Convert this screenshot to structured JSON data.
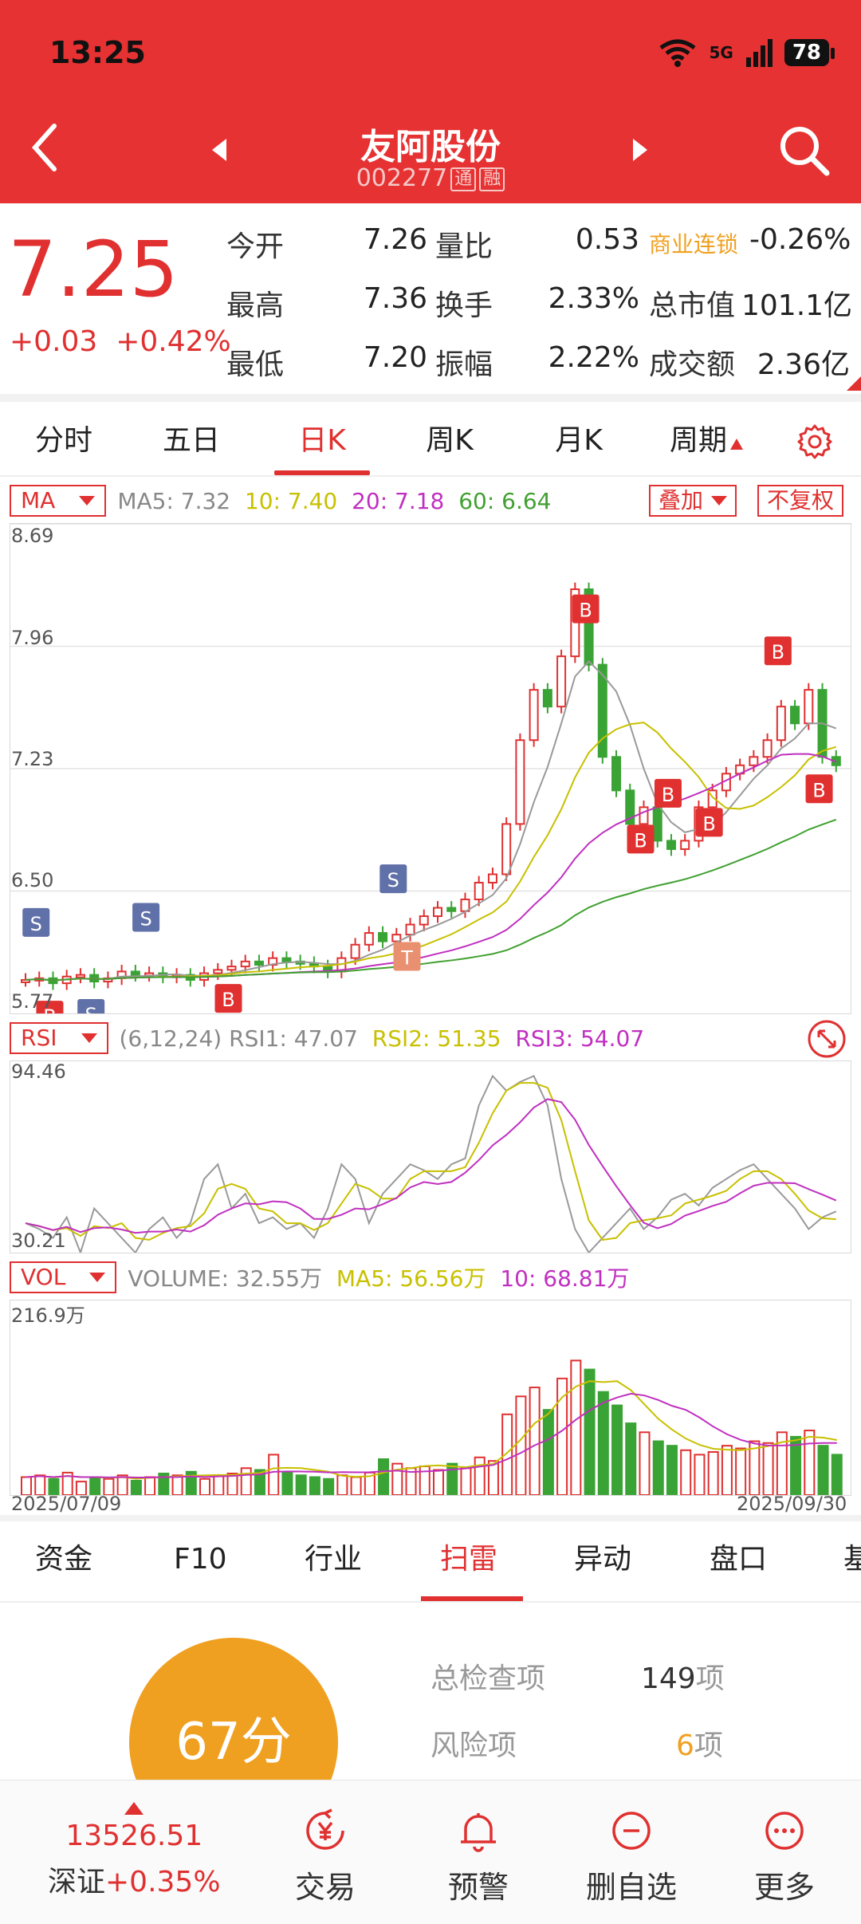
{
  "status": {
    "time": "13:25",
    "net": "5G",
    "battery": "78"
  },
  "header": {
    "name": "友阿股份",
    "code": "002277",
    "badge1": "通",
    "badge2": "融"
  },
  "quote": {
    "price": "7.25",
    "change": "+0.03",
    "change_pct": "+0.42%",
    "open_label": "今开",
    "open": "7.26",
    "high_label": "最高",
    "high": "7.36",
    "low_label": "最低",
    "low": "7.20",
    "vol_ratio_label": "量比",
    "vol_ratio": "0.53",
    "turnover_label": "换手",
    "turnover": "2.33%",
    "amplitude_label": "振幅",
    "amplitude": "2.22%",
    "sector_label": "商业连锁",
    "sector_change": "-0.26%",
    "mcap_label": "总市值",
    "mcap": "101.1亿",
    "amount_label": "成交额",
    "amount": "2.36亿"
  },
  "tabs": [
    "分时",
    "五日",
    "日K",
    "周K",
    "月K",
    "周期"
  ],
  "ma_bar": {
    "select": "MA",
    "ma5": "MA5: 7.32",
    "ma10": "10: 7.40",
    "ma20": "20: 7.18",
    "ma60": "60: 6.64",
    "overlay": "叠加",
    "adjust": "不复权"
  },
  "kline": {
    "y_ticks": [
      "8.69",
      "7.96",
      "7.23",
      "6.50",
      "5.77"
    ]
  },
  "rsi_bar": {
    "select": "RSI",
    "params": "(6,12,24)",
    "rsi1": "RSI1: 47.07",
    "rsi2": "RSI2: 51.35",
    "rsi3": "RSI3: 54.07"
  },
  "rsi_axis": {
    "top": "94.46",
    "bottom": "30.21"
  },
  "vol_bar": {
    "select": "VOL",
    "volume": "VOLUME: 32.55万",
    "ma5": "MA5: 56.56万",
    "ma10": "10: 68.81万"
  },
  "vol_axis": {
    "top": "216.9万",
    "start_date": "2025/07/09",
    "end_date": "2025/09/30"
  },
  "markers": {
    "b": "B",
    "s": "S",
    "t": "T"
  },
  "modules": [
    "资金",
    "F10",
    "行业",
    "扫雷",
    "异动",
    "盘口",
    "基"
  ],
  "scan": {
    "score": "67分",
    "total_label": "总检查项",
    "total_num": "149",
    "unit": "项",
    "risk_label": "风险项",
    "risk_num": "6"
  },
  "bottom": {
    "index_value": "13526.51",
    "index_name": "深证",
    "index_change": "+0.35%",
    "trade": "交易",
    "alert": "预警",
    "remove": "删自选",
    "more": "更多"
  },
  "colors": {
    "brand": "#e63232",
    "up": "#e03030",
    "down": "#3aa335",
    "orange": "#f0a020"
  },
  "icons": [
    "back-icon",
    "prev-icon",
    "next-icon",
    "search-icon",
    "wifi-icon",
    "signal-icon",
    "battery-icon",
    "settings-icon",
    "expand-icon",
    "yuan-icon",
    "bell-icon",
    "minus-circle-icon",
    "more-icon"
  ]
}
